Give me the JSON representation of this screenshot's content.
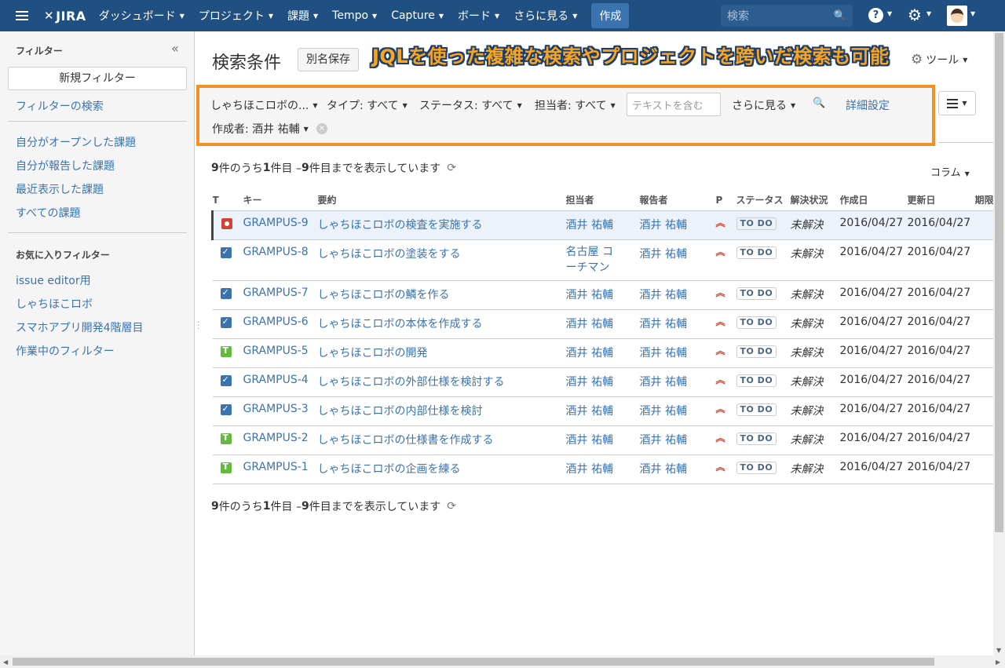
{
  "topnav": {
    "logo": "JIRA",
    "items": [
      {
        "label": "ダッシュボード"
      },
      {
        "label": "プロジェクト"
      },
      {
        "label": "課題"
      },
      {
        "label": "Tempo"
      },
      {
        "label": "Capture"
      },
      {
        "label": "ボード"
      },
      {
        "label": "さらに見る"
      }
    ],
    "create": "作成",
    "search_placeholder": "検索",
    "help": "?"
  },
  "sidebar": {
    "title": "フィルター",
    "collapse": "«",
    "new_filter": "新規フィルター",
    "find_filters": "フィルターの検索",
    "system_filters": [
      {
        "label": "自分がオープンした課題"
      },
      {
        "label": "自分が報告した課題"
      },
      {
        "label": "最近表示した課題"
      },
      {
        "label": "すべての課題"
      }
    ],
    "favorites_title": "お気に入りフィルター",
    "favorites": [
      {
        "label": "issue editor用"
      },
      {
        "label": "しゃちほこロボ"
      },
      {
        "label": "スマホアプリ開発4階層目"
      },
      {
        "label": "作業中のフィルター"
      }
    ]
  },
  "header": {
    "title": "検索条件",
    "save_as": "別名保存",
    "banner": "JQLを使った複雑な検索やプロジェクトを跨いだ検索も可能",
    "tools": "ツール"
  },
  "filters": {
    "project": "しゃちほこロボの...",
    "type": "タイプ: すべて",
    "status": "ステータス: すべて",
    "assignee": "担当者: すべて",
    "text_placeholder": "テキストを含む",
    "more": "さらに見る",
    "advanced": "詳細設定",
    "creator": "作成者: 酒井 祐輔",
    "remove": "×"
  },
  "results": {
    "count_n": "9",
    "count_text1": " 件のうち ",
    "count_start": "1",
    "count_text2": " 件目 – ",
    "count_end": "9",
    "count_text3": " 件目までを表示しています",
    "columns": "コラム"
  },
  "table": {
    "headers": {
      "type": "T",
      "key": "キー",
      "summary": "要約",
      "assignee": "担当者",
      "reporter": "報告者",
      "priority": "P",
      "status": "ステータス",
      "resolution": "解決状況",
      "created": "作成日",
      "updated": "更新日",
      "due": "期限"
    },
    "rows": [
      {
        "type": "bug",
        "key": "GRAMPUS-9",
        "summary": "しゃちほこロボの検査を実施する",
        "assignee": "酒井 祐輔",
        "reporter": "酒井 祐輔",
        "status": "TO DO",
        "resolution": "未解決",
        "created": "2016/04/27",
        "updated": "2016/04/27"
      },
      {
        "type": "task",
        "key": "GRAMPUS-8",
        "summary": "しゃちほこロボの塗装をする",
        "assignee": "名古屋 コーチマン",
        "reporter": "酒井 祐輔",
        "status": "TO DO",
        "resolution": "未解決",
        "created": "2016/04/27",
        "updated": "2016/04/27"
      },
      {
        "type": "task",
        "key": "GRAMPUS-7",
        "summary": "しゃちほこロボの鱗を作る",
        "assignee": "酒井 祐輔",
        "reporter": "酒井 祐輔",
        "status": "TO DO",
        "resolution": "未解決",
        "created": "2016/04/27",
        "updated": "2016/04/27"
      },
      {
        "type": "task",
        "key": "GRAMPUS-6",
        "summary": "しゃちほこロボの本体を作成する",
        "assignee": "酒井 祐輔",
        "reporter": "酒井 祐輔",
        "status": "TO DO",
        "resolution": "未解決",
        "created": "2016/04/27",
        "updated": "2016/04/27"
      },
      {
        "type": "story",
        "key": "GRAMPUS-5",
        "summary": "しゃちほこロボの開発",
        "assignee": "酒井 祐輔",
        "reporter": "酒井 祐輔",
        "status": "TO DO",
        "resolution": "未解決",
        "created": "2016/04/27",
        "updated": "2016/04/27"
      },
      {
        "type": "task",
        "key": "GRAMPUS-4",
        "summary": "しゃちほこロボの外部仕様を検討する",
        "assignee": "酒井 祐輔",
        "reporter": "酒井 祐輔",
        "status": "TO DO",
        "resolution": "未解決",
        "created": "2016/04/27",
        "updated": "2016/04/27"
      },
      {
        "type": "task",
        "key": "GRAMPUS-3",
        "summary": "しゃちほこロボの内部仕様を検討",
        "assignee": "酒井 祐輔",
        "reporter": "酒井 祐輔",
        "status": "TO DO",
        "resolution": "未解決",
        "created": "2016/04/27",
        "updated": "2016/04/27"
      },
      {
        "type": "story",
        "key": "GRAMPUS-2",
        "summary": "しゃちほこロボの仕様書を作成する",
        "assignee": "酒井 祐輔",
        "reporter": "酒井 祐輔",
        "status": "TO DO",
        "resolution": "未解決",
        "created": "2016/04/27",
        "updated": "2016/04/27"
      },
      {
        "type": "story",
        "key": "GRAMPUS-1",
        "summary": "しゃちほこロボの企画を練る",
        "assignee": "酒井 祐輔",
        "reporter": "酒井 祐輔",
        "status": "TO DO",
        "resolution": "未解決",
        "created": "2016/04/27",
        "updated": "2016/04/27"
      }
    ]
  }
}
